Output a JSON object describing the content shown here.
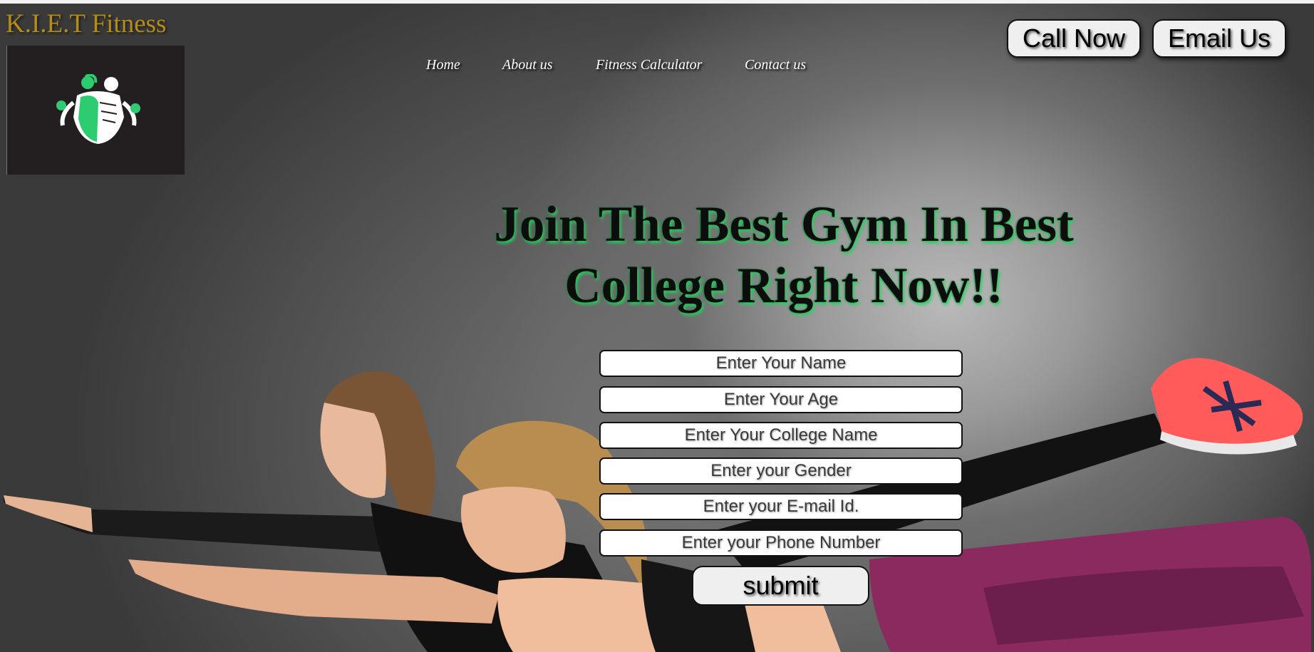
{
  "brand": {
    "name": "K.I.E.T Fitness",
    "logo_icon": "fitness-couple-icon",
    "logo_accent": "#2ecc71"
  },
  "nav": {
    "items": [
      {
        "label": "Home"
      },
      {
        "label": "About us"
      },
      {
        "label": "Fitness Calculator"
      },
      {
        "label": "Contact us"
      }
    ]
  },
  "header_actions": {
    "call_label": "Call Now",
    "email_label": "Email Us"
  },
  "hero": {
    "headline_line1": "Join The Best Gym In Best",
    "headline_line2": "College Right Now!!",
    "headline_glow_color": "#1fd35b",
    "image_icon": "women-stretching-photo"
  },
  "form": {
    "fields": [
      {
        "placeholder": "Enter Your Name",
        "value": ""
      },
      {
        "placeholder": "Enter Your Age",
        "value": ""
      },
      {
        "placeholder": "Enter Your College Name",
        "value": ""
      },
      {
        "placeholder": "Enter your Gender",
        "value": ""
      },
      {
        "placeholder": "Enter your E-mail Id.",
        "value": ""
      },
      {
        "placeholder": "Enter your Phone Number",
        "value": ""
      }
    ],
    "submit_label": "submit"
  }
}
